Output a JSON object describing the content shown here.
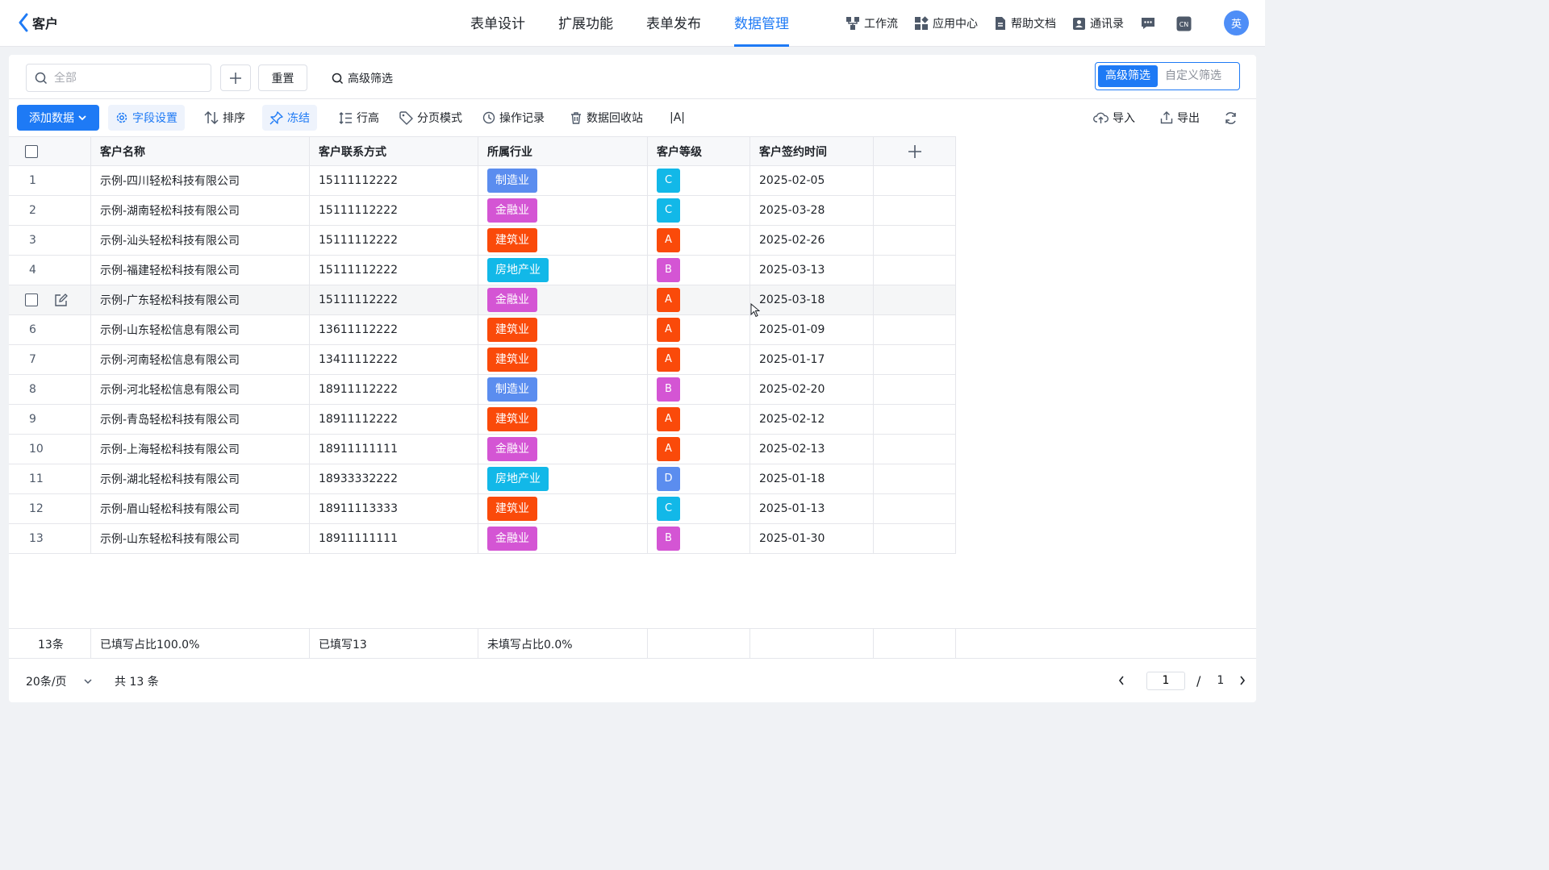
{
  "header": {
    "app_title": "客户",
    "tabs": [
      {
        "label": "表单设计"
      },
      {
        "label": "扩展功能"
      },
      {
        "label": "表单发布"
      },
      {
        "label": "数据管理"
      }
    ],
    "actions": [
      {
        "label": "工作流",
        "icon": "workflow-icon"
      },
      {
        "label": "应用中心",
        "icon": "app-center-icon"
      },
      {
        "label": "帮助文档",
        "icon": "document-icon"
      },
      {
        "label": "通讯录",
        "icon": "contacts-icon"
      }
    ],
    "lang_badge": "CN",
    "avatar_text": "英"
  },
  "filter": {
    "search_placeholder": "全部",
    "reset_label": "重置",
    "advanced_link": "高级筛选",
    "seg_advanced": "高级筛选",
    "seg_custom": "自定义筛选"
  },
  "toolbar": {
    "add_data": "添加数据",
    "field_settings": "字段设置",
    "sort": "排序",
    "freeze": "冻结",
    "row_height": "行高",
    "page_mode": "分页模式",
    "op_log": "操作记录",
    "recycle": "数据回收站",
    "text_size": "|A|",
    "import": "导入",
    "export": "导出"
  },
  "colors": {
    "primary": "#1e7af5",
    "制造业": "#5b8def",
    "金融业": "#d455d4",
    "建筑业": "#fa4a0a",
    "房地产业": "#12b8e8",
    "A": "#fa4a0a",
    "B": "#d455d4",
    "C": "#12b8e8",
    "D": "#5b8def"
  },
  "table": {
    "columns": [
      "客户名称",
      "客户联系方式",
      "所属行业",
      "客户等级",
      "客户签约时间"
    ],
    "rows": [
      {
        "no": "1",
        "name": "示例-四川轻松科技有限公司",
        "phone": "15111112222",
        "industry": "制造业",
        "grade": "C",
        "date": "2025-02-05"
      },
      {
        "no": "2",
        "name": "示例-湖南轻松科技有限公司",
        "phone": "15111112222",
        "industry": "金融业",
        "grade": "C",
        "date": "2025-03-28"
      },
      {
        "no": "3",
        "name": "示例-汕头轻松科技有限公司",
        "phone": "15111112222",
        "industry": "建筑业",
        "grade": "A",
        "date": "2025-02-26"
      },
      {
        "no": "4",
        "name": "示例-福建轻松科技有限公司",
        "phone": "15111112222",
        "industry": "房地产业",
        "grade": "B",
        "date": "2025-03-13"
      },
      {
        "no": "5",
        "name": "示例-广东轻松科技有限公司",
        "phone": "15111112222",
        "industry": "金融业",
        "grade": "A",
        "date": "2025-03-18"
      },
      {
        "no": "6",
        "name": "示例-山东轻松信息有限公司",
        "phone": "13611112222",
        "industry": "建筑业",
        "grade": "A",
        "date": "2025-01-09"
      },
      {
        "no": "7",
        "name": "示例-河南轻松信息有限公司",
        "phone": "13411112222",
        "industry": "建筑业",
        "grade": "A",
        "date": "2025-01-17"
      },
      {
        "no": "8",
        "name": "示例-河北轻松信息有限公司",
        "phone": "18911112222",
        "industry": "制造业",
        "grade": "B",
        "date": "2025-02-20"
      },
      {
        "no": "9",
        "name": "示例-青岛轻松科技有限公司",
        "phone": "18911112222",
        "industry": "建筑业",
        "grade": "A",
        "date": "2025-02-12"
      },
      {
        "no": "10",
        "name": "示例-上海轻松科技有限公司",
        "phone": "18911111111",
        "industry": "金融业",
        "grade": "A",
        "date": "2025-02-13"
      },
      {
        "no": "11",
        "name": "示例-湖北轻松科技有限公司",
        "phone": "18933332222",
        "industry": "房地产业",
        "grade": "D",
        "date": "2025-01-18"
      },
      {
        "no": "12",
        "name": "示例-眉山轻松科技有限公司",
        "phone": "18911113333",
        "industry": "建筑业",
        "grade": "C",
        "date": "2025-01-13"
      },
      {
        "no": "13",
        "name": "示例-山东轻松科技有限公司",
        "phone": "18911111111",
        "industry": "金融业",
        "grade": "B",
        "date": "2025-01-30"
      }
    ],
    "hover_row_index": 4
  },
  "summary": {
    "count": "13条",
    "name_fill": "已填写占比100.0%",
    "phone_fill": "已填写13",
    "industry_fill": "未填写占比0.0%"
  },
  "footer": {
    "page_size": "20条/页",
    "total": "共 13 条",
    "current_page": "1",
    "page_sep": "/",
    "total_pages": "1"
  }
}
